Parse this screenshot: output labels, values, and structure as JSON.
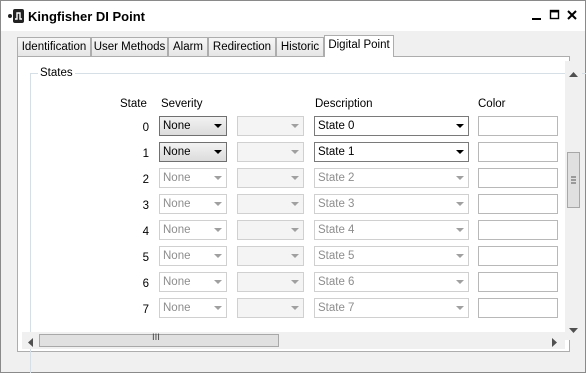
{
  "window": {
    "title": "Kingfisher DI Point"
  },
  "tabs": [
    {
      "label": "Identification",
      "active": false
    },
    {
      "label": "User Methods",
      "active": false
    },
    {
      "label": "Alarm",
      "active": false
    },
    {
      "label": "Redirection",
      "active": false
    },
    {
      "label": "Historic",
      "active": false
    },
    {
      "label": "Digital Point",
      "active": true
    }
  ],
  "states_group": {
    "label": "States",
    "headers": {
      "state": "State",
      "severity": "Severity",
      "description": "Description",
      "color": "Color"
    },
    "rows": [
      {
        "state": "0",
        "severity": "None",
        "description": "State 0",
        "enabled": true
      },
      {
        "state": "1",
        "severity": "None",
        "description": "State 1",
        "enabled": true
      },
      {
        "state": "2",
        "severity": "None",
        "description": "State 2",
        "enabled": false
      },
      {
        "state": "3",
        "severity": "None",
        "description": "State 3",
        "enabled": false
      },
      {
        "state": "4",
        "severity": "None",
        "description": "State 4",
        "enabled": false
      },
      {
        "state": "5",
        "severity": "None",
        "description": "State 5",
        "enabled": false
      },
      {
        "state": "6",
        "severity": "None",
        "description": "State 6",
        "enabled": false
      },
      {
        "state": "7",
        "severity": "None",
        "description": "State 7",
        "enabled": false
      }
    ]
  },
  "scrollbar": {
    "h_grip": "III"
  }
}
